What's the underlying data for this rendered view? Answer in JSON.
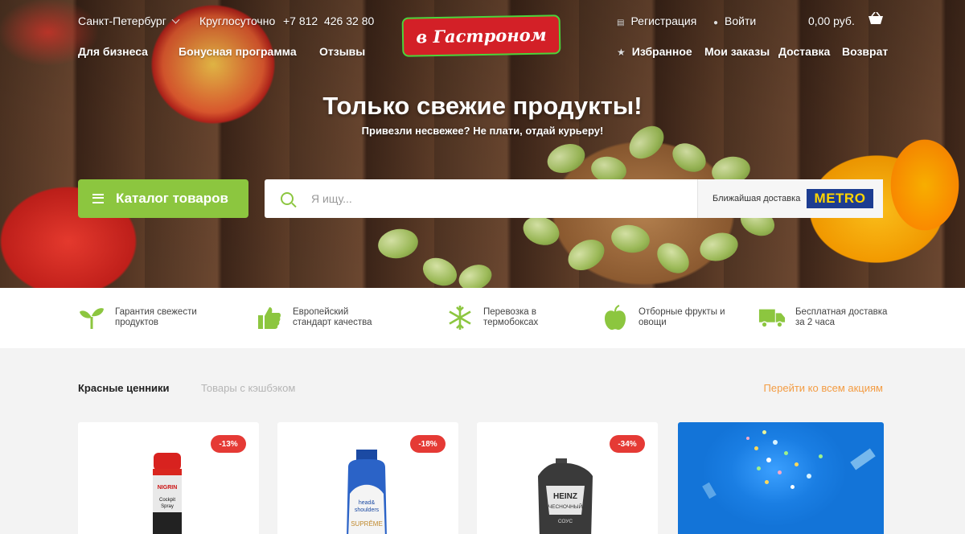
{
  "header": {
    "city": "Санкт-Петербург",
    "hours": "Круглосуточно",
    "phone": "+7 812  426 32 80",
    "links_left": [
      "Для бизнеса",
      "Бонусная программа",
      "Отзывы"
    ],
    "register": "Регистрация",
    "login": "Войти",
    "cart_total": "0,00 руб.",
    "links_right": [
      "Избранное",
      "Мои заказы",
      "Доставка",
      "Возврат"
    ],
    "logo_text": "в Гастроном"
  },
  "hero": {
    "title": "Только свежие продукты!",
    "subtitle": "Привезли несвежее? Не плати, отдай курьеру!",
    "catalog_button": "Каталог товаров",
    "search_placeholder": "Я ищу...",
    "nearest_delivery": "Ближайшая доставка",
    "partner_logo": "METRO"
  },
  "features": [
    {
      "icon": "sprout-icon",
      "text": "Гарантия свежести продуктов"
    },
    {
      "icon": "thumbs-up-icon",
      "text": "Европейский стандарт качества"
    },
    {
      "icon": "snowflake-icon",
      "text": "Перевозка в термобоксах"
    },
    {
      "icon": "apple-icon",
      "text": "Отборные фрукты и овощи"
    },
    {
      "icon": "truck-icon",
      "text": "Бесплатная доставка за 2 часа"
    }
  ],
  "promos": {
    "tabs": [
      "Красные ценники",
      "Товары с кэшбэком"
    ],
    "all_link": "Перейти ко всем акциям",
    "products": [
      {
        "discount": "-13%",
        "label": "NIGRIN Cockpit Spray"
      },
      {
        "discount": "-18%",
        "label": "head & shoulders SUPRÊME"
      },
      {
        "discount": "-34%",
        "label": "HEINZ ЧЕСНОЧНЫЙ СОУС"
      }
    ]
  },
  "colors": {
    "accent_green": "#8cc63f",
    "logo_red": "#d32027",
    "badge_red": "#e53a35",
    "link_orange": "#f39c43",
    "metro_blue": "#1d3d91",
    "metro_yellow": "#ffd500"
  }
}
